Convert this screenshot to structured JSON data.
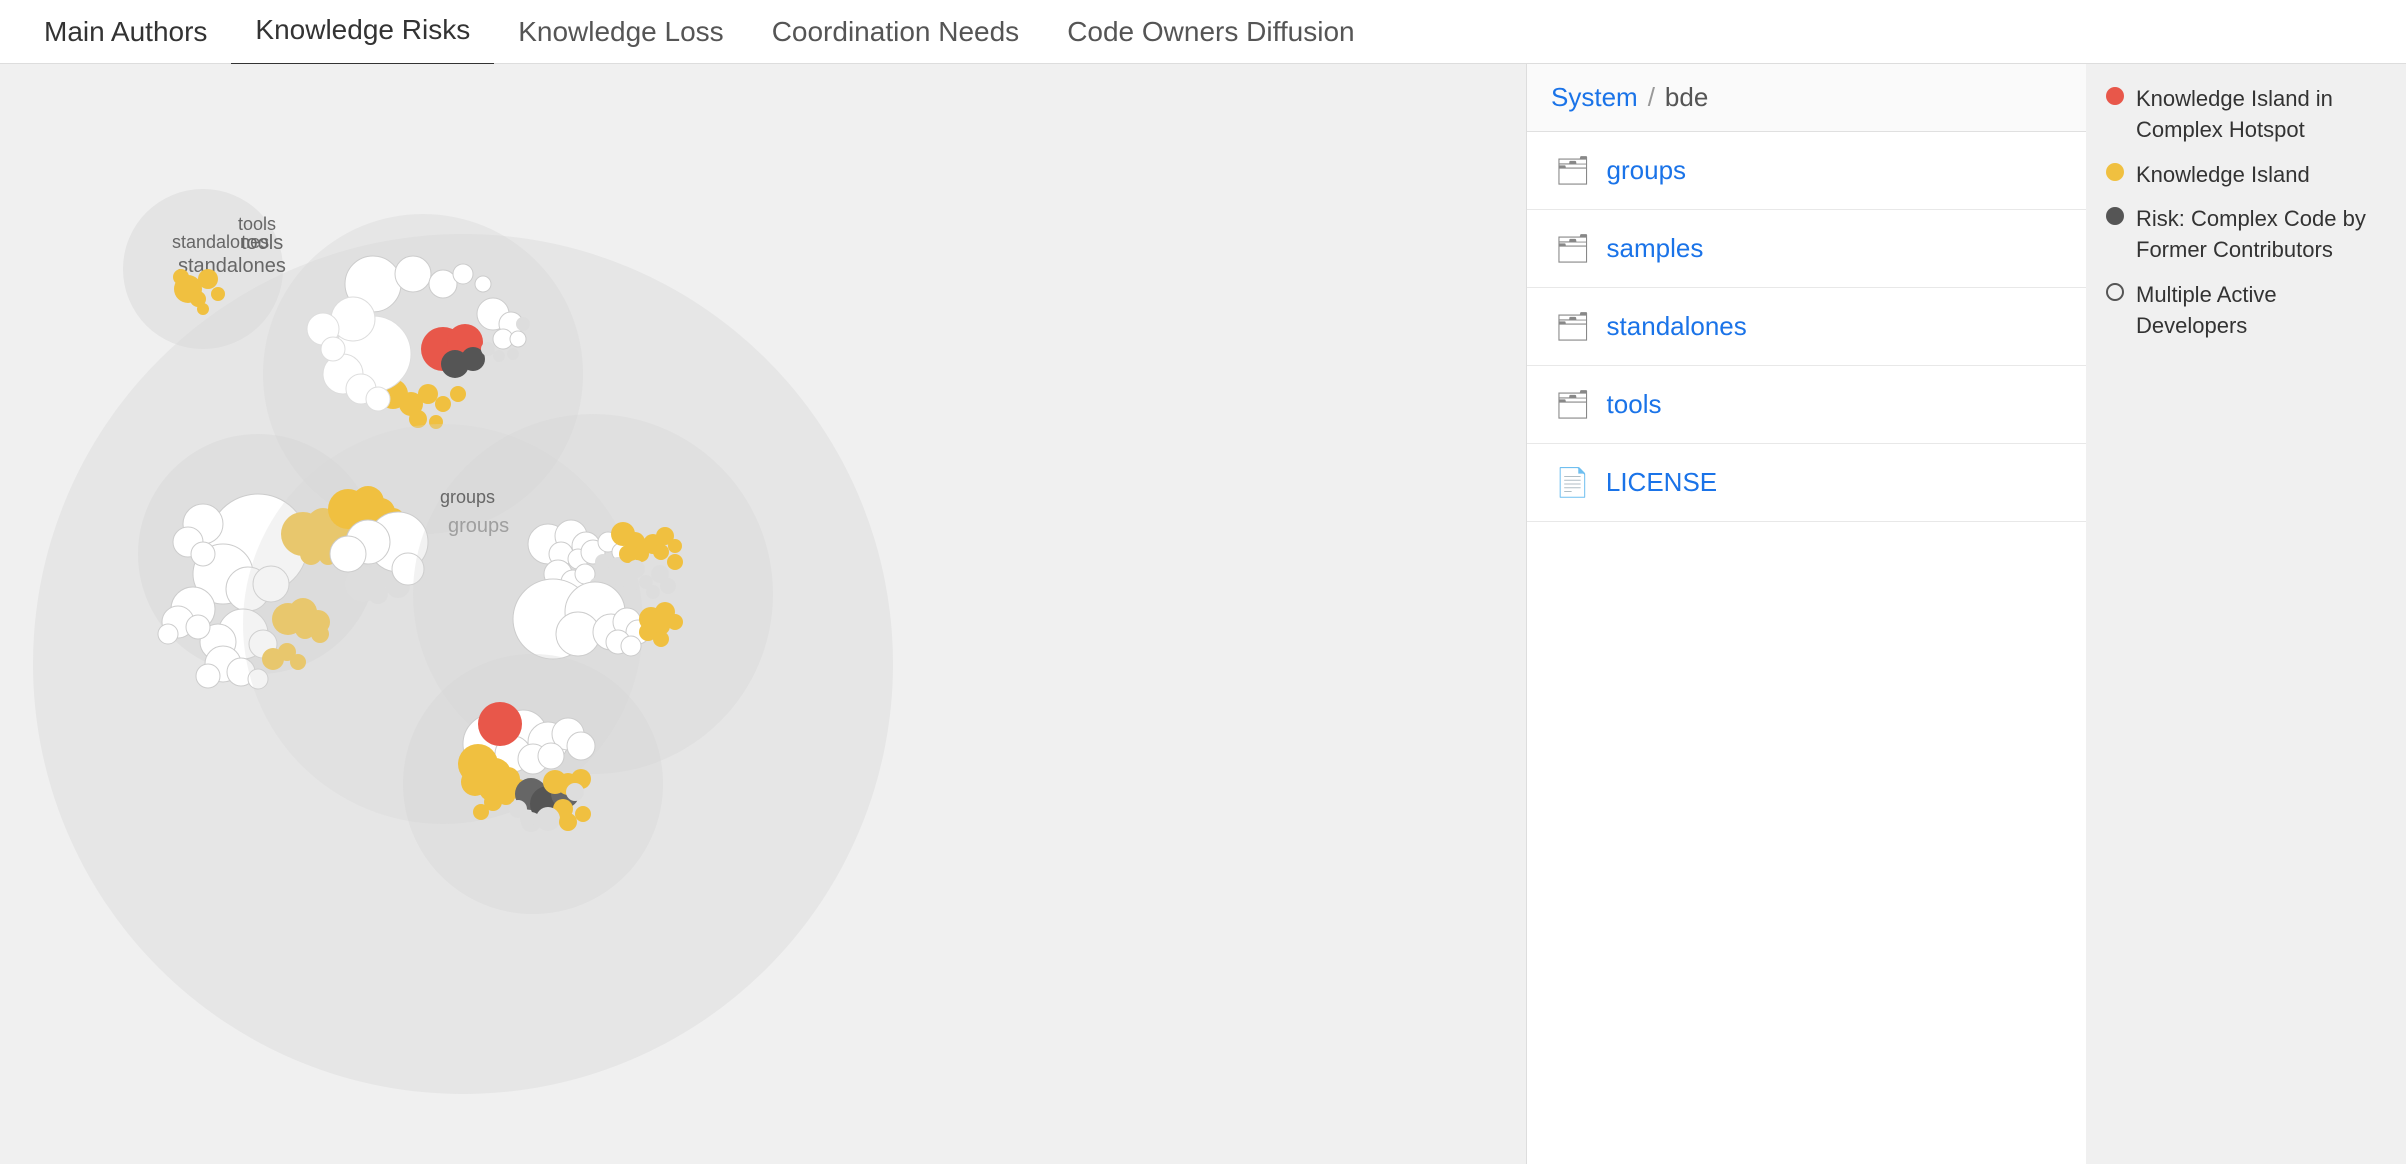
{
  "nav": {
    "tabs": [
      {
        "label": "Main Authors",
        "active": false
      },
      {
        "label": "Knowledge Risks",
        "active": true
      },
      {
        "label": "Knowledge Loss",
        "active": false
      },
      {
        "label": "Coordination Needs",
        "active": false
      },
      {
        "label": "Code Owners Diffusion",
        "active": false
      }
    ]
  },
  "breadcrumb": {
    "system_label": "System",
    "separator": "/",
    "current": "bde"
  },
  "files": [
    {
      "type": "folder",
      "name": "groups"
    },
    {
      "type": "folder",
      "name": "samples"
    },
    {
      "type": "folder",
      "name": "standalones"
    },
    {
      "type": "folder",
      "name": "tools"
    },
    {
      "type": "file",
      "name": "LICENSE"
    }
  ],
  "legend": {
    "items": [
      {
        "color": "#e84b3a",
        "type": "dot",
        "label": "Knowledge Island in Complex Hotspot"
      },
      {
        "color": "#f0c040",
        "type": "dot",
        "label": "Knowledge Island"
      },
      {
        "color": "#555555",
        "type": "dot",
        "label": "Risk: Complex Code by Former Contributors"
      },
      {
        "color": "transparent",
        "type": "outline",
        "label": "Multiple Active Developers"
      }
    ]
  },
  "viz_labels": {
    "tools": "tools",
    "standalones": "standalones",
    "groups": "groups"
  }
}
